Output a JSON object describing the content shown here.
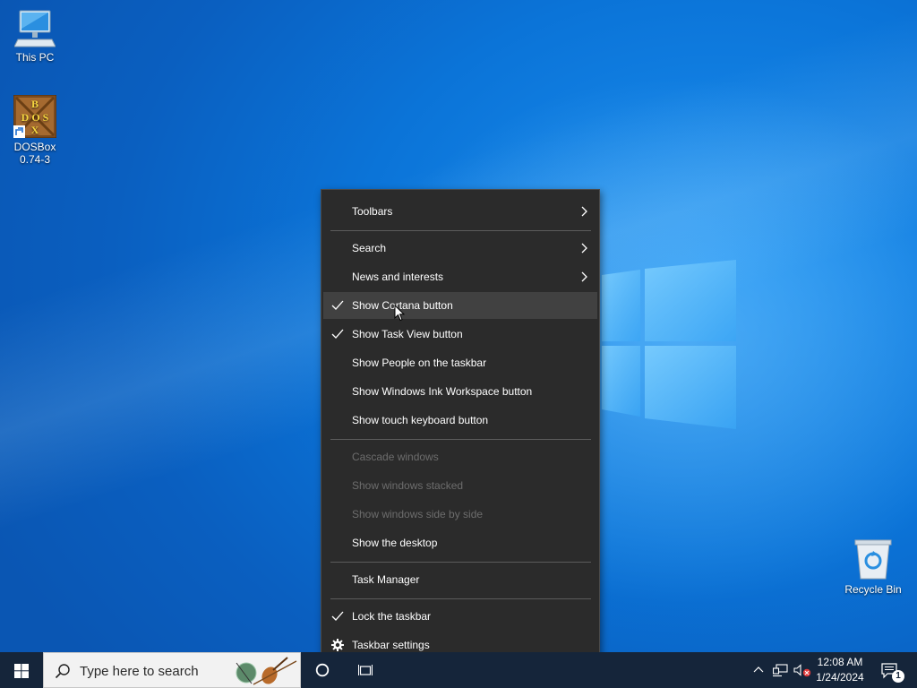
{
  "desktop": {
    "icons": [
      {
        "label": "This PC",
        "icon": "computer-icon"
      },
      {
        "label": "DOSBox\n0.74-3",
        "label_line1": "DOSBox",
        "label_line2": "0.74-3",
        "icon": "dosbox-icon",
        "logo_letters": "DOS BOX"
      },
      {
        "label": "Recycle Bin",
        "icon": "recycle-bin-icon"
      }
    ]
  },
  "context_menu": {
    "items": [
      {
        "label": "Toolbars",
        "submenu": true
      },
      {
        "label": "Search",
        "submenu": true
      },
      {
        "label": "News and interests",
        "submenu": true
      },
      {
        "label": "Show Cortana button",
        "checked": true,
        "hovered": true
      },
      {
        "label": "Show Task View button",
        "checked": true
      },
      {
        "label": "Show People on the taskbar"
      },
      {
        "label": "Show Windows Ink Workspace button"
      },
      {
        "label": "Show touch keyboard button"
      },
      {
        "label": "Cascade windows",
        "disabled": true
      },
      {
        "label": "Show windows stacked",
        "disabled": true
      },
      {
        "label": "Show windows side by side",
        "disabled": true
      },
      {
        "label": "Show the desktop"
      },
      {
        "label": "Task Manager"
      },
      {
        "label": "Lock the taskbar",
        "checked": true
      },
      {
        "label": "Taskbar settings",
        "icon": "gear-icon"
      }
    ]
  },
  "taskbar": {
    "search_placeholder": "Type here to search",
    "clock": {
      "time": "12:08 AM",
      "date": "1/24/2024"
    },
    "notification_count": "1"
  },
  "colors": {
    "menu_bg": "#2b2b2b",
    "menu_hover": "#414141",
    "menu_disabled_text": "#6d6d6d",
    "taskbar_bg": "#15253a",
    "wallpaper_blue": "#0b74d8"
  }
}
